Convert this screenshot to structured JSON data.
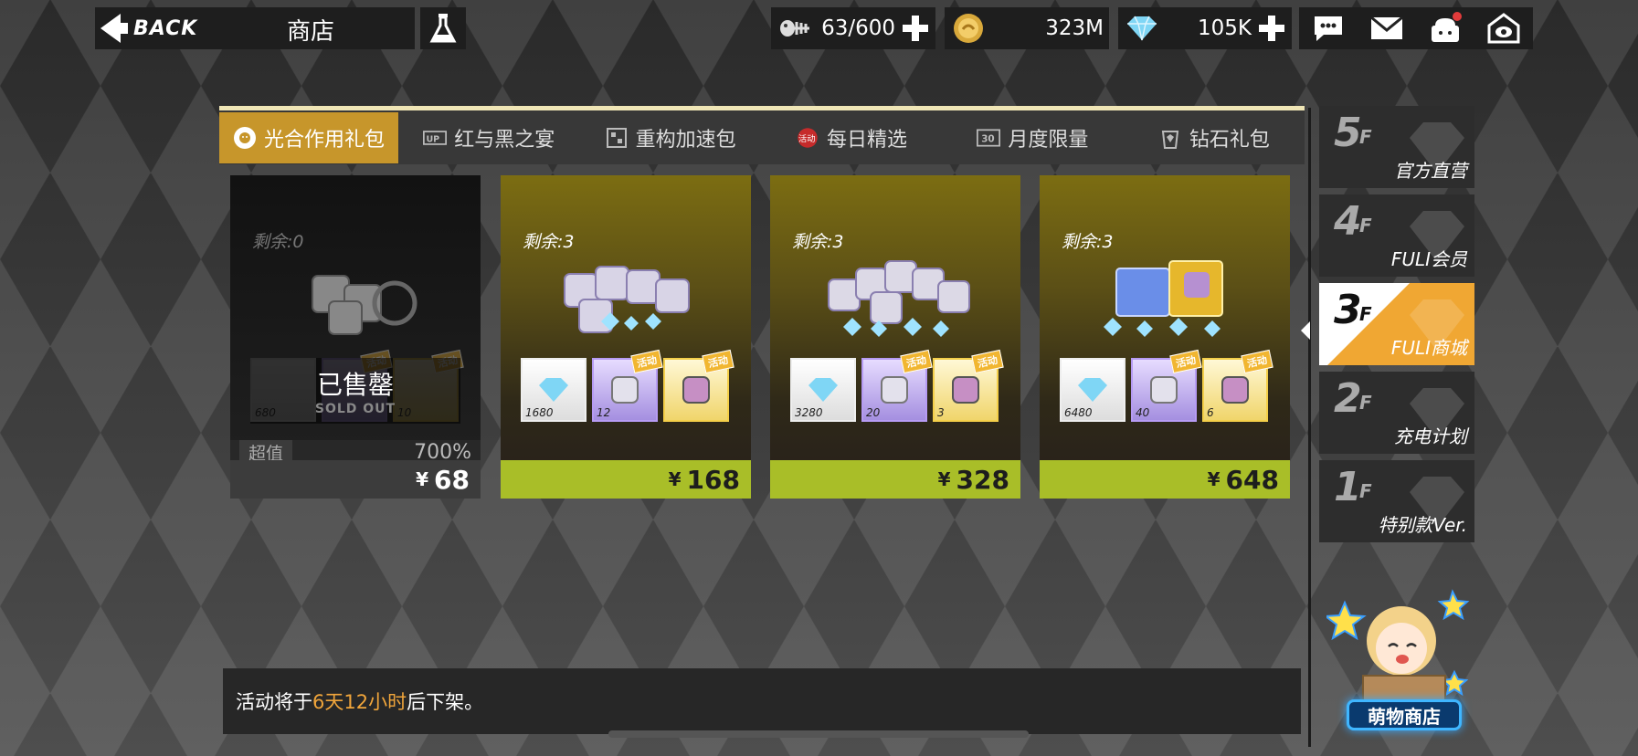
{
  "header": {
    "back_label": "BACK",
    "title": "商店",
    "resources": [
      {
        "name": "stamina",
        "icon": "fish-bone-icon",
        "value": "63/600"
      },
      {
        "name": "coins",
        "icon": "coin-icon",
        "value": "323M"
      },
      {
        "name": "diamonds",
        "icon": "diamond-icon",
        "value": "105K"
      }
    ]
  },
  "tabs": [
    {
      "label": "光合作用礼包",
      "icon": "flower-icon",
      "active": true
    },
    {
      "label": "红与黑之宴",
      "icon": "up-badge-icon",
      "active": false
    },
    {
      "label": "重构加速包",
      "icon": "grid-icon",
      "active": false
    },
    {
      "label": "每日精选",
      "icon": "activity-badge-icon",
      "badge": "活动",
      "active": false
    },
    {
      "label": "月度限量",
      "icon": "thirty-badge-icon",
      "badge": "30",
      "active": false
    },
    {
      "label": "钻石礼包",
      "icon": "gem-bag-icon",
      "active": false
    }
  ],
  "cards": [
    {
      "remain": "剩余:0",
      "sold_out": true,
      "sold_out_label": "已售罄",
      "sold_out_sub": "SOLD OUT",
      "tag": "超值",
      "percent": "700%",
      "items": [
        {
          "type": "gem",
          "qty": "680",
          "badge": ""
        },
        {
          "type": "purple",
          "qty": "",
          "badge": "活动"
        },
        {
          "type": "yellow",
          "qty": "10",
          "badge": "活动"
        }
      ],
      "currency": "¥",
      "price": "68"
    },
    {
      "remain": "剩余:3",
      "sold_out": false,
      "items": [
        {
          "type": "gem",
          "qty": "1680",
          "badge": ""
        },
        {
          "type": "purple",
          "qty": "12",
          "badge": "活动"
        },
        {
          "type": "yellow",
          "qty": "",
          "badge": "活动"
        }
      ],
      "currency": "¥",
      "price": "168"
    },
    {
      "remain": "剩余:3",
      "sold_out": false,
      "items": [
        {
          "type": "gem",
          "qty": "3280",
          "badge": ""
        },
        {
          "type": "purple",
          "qty": "20",
          "badge": "活动"
        },
        {
          "type": "yellow",
          "qty": "3",
          "badge": "活动"
        }
      ],
      "currency": "¥",
      "price": "328"
    },
    {
      "remain": "剩余:3",
      "sold_out": false,
      "items": [
        {
          "type": "gem",
          "qty": "6480",
          "badge": ""
        },
        {
          "type": "purple",
          "qty": "40",
          "badge": "活动"
        },
        {
          "type": "yellow",
          "qty": "6",
          "badge": "活动"
        }
      ],
      "currency": "¥",
      "price": "648"
    }
  ],
  "notice": {
    "prefix": "活动将于",
    "highlight": "6天12小时",
    "suffix": "后下架。"
  },
  "floors": [
    {
      "num": "5",
      "suffix": "F",
      "name": "官方直营",
      "active": false
    },
    {
      "num": "4",
      "suffix": "F",
      "name": "FULI会员",
      "active": false
    },
    {
      "num": "3",
      "suffix": "F",
      "name": "FULI商城",
      "active": true
    },
    {
      "num": "2",
      "suffix": "F",
      "name": "充电计划",
      "active": false
    },
    {
      "num": "1",
      "suffix": "F",
      "name": "特别款Ver.",
      "active": false
    }
  ],
  "mascot_shop_label": "萌物商店",
  "colors": {
    "accent": "#c7962b",
    "price_bar": "#a9be28",
    "highlight": "#f0a53b",
    "active_floor": "#f0a733"
  }
}
